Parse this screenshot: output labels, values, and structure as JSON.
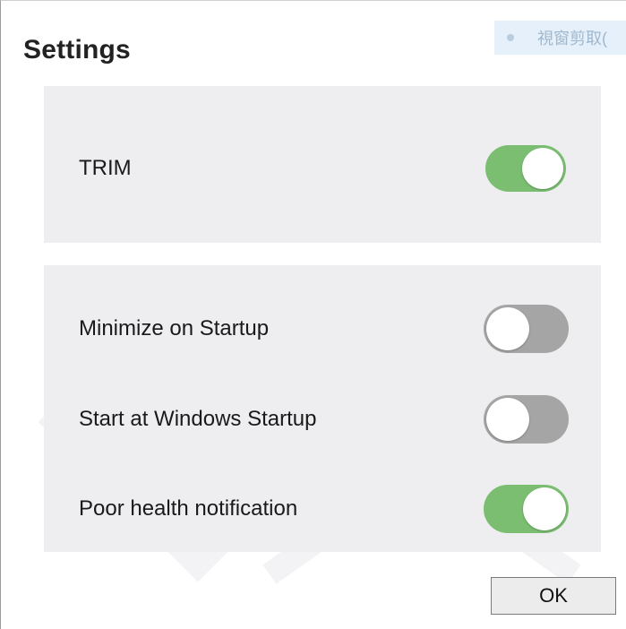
{
  "window": {
    "title": "Settings",
    "snip_badge": "視窗剪取("
  },
  "trim_panel": {
    "items": [
      {
        "label": "TRIM",
        "enabled": true
      }
    ]
  },
  "startup_panel": {
    "items": [
      {
        "label": "Minimize on Startup",
        "enabled": false
      },
      {
        "label": "Start at Windows Startup",
        "enabled": false
      },
      {
        "label": "Poor health notification",
        "enabled": true
      }
    ]
  },
  "footer": {
    "ok_label": "OK"
  },
  "colors": {
    "toggle_on": "#7bbe72",
    "toggle_off": "#a5a5a5",
    "panel_bg": "#eeedf0"
  }
}
